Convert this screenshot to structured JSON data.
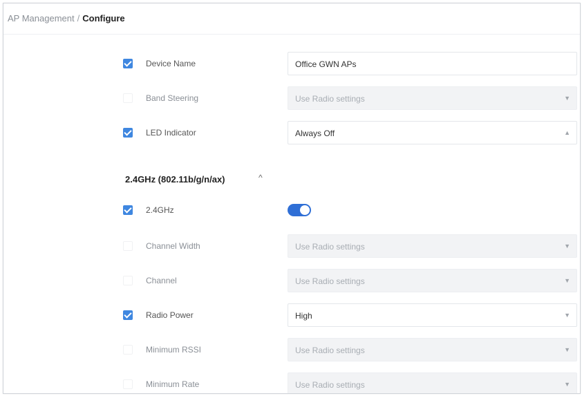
{
  "breadcrumb": {
    "parent": "AP Management",
    "separator": "/",
    "current": "Configure"
  },
  "rows": [
    {
      "label": "Device Name",
      "checked": true,
      "value": "Office GWN APs"
    },
    {
      "label": "Band Steering",
      "checked": false,
      "value": "Use Radio settings"
    },
    {
      "label": "LED Indicator",
      "checked": true,
      "value": "Always Off"
    }
  ],
  "section": {
    "title": "2.4GHz (802.11b/g/n/ax)",
    "chevron": "^"
  },
  "radio_rows": [
    {
      "label": "2.4GHz",
      "checked": true,
      "toggle_on": true
    },
    {
      "label": "Channel Width",
      "checked": false,
      "value": "Use Radio settings"
    },
    {
      "label": "Channel",
      "checked": false,
      "value": "Use Radio settings"
    },
    {
      "label": "Radio Power",
      "checked": true,
      "value": "High"
    },
    {
      "label": "Minimum RSSI",
      "checked": false,
      "value": "Use Radio settings"
    },
    {
      "label": "Minimum Rate",
      "checked": false,
      "value": "Use Radio settings"
    }
  ],
  "icons": {
    "caret": "chevron-down-icon",
    "section": "chevron-up-icon",
    "check": "check-icon"
  },
  "colors": {
    "accent": "#3f87e0",
    "toggle": "#2f6fd6",
    "disabled_bg": "#f2f3f5"
  }
}
